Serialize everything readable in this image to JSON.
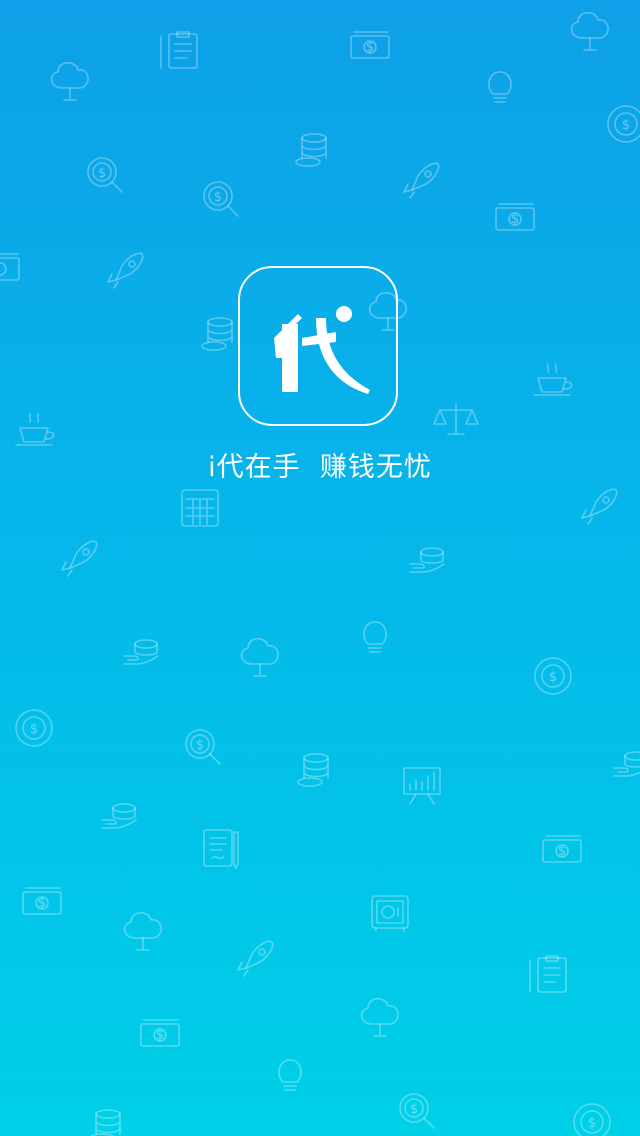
{
  "splash": {
    "slogan": "i代在手  赚钱无忧",
    "logo_icon": "dai-character-logo-icon",
    "background_gradient": [
      "#0ea0e8",
      "#00d0e8"
    ],
    "accent_color": "#ffffff"
  },
  "pattern": {
    "dollar_symbol": "$",
    "icons": [
      "money-tree-icon",
      "clipboard-icon",
      "banknote-icon",
      "lightbulb-icon",
      "coin-stack-icon",
      "dollar-magnifier-icon",
      "rocket-icon",
      "dollar-coin-icon",
      "coffee-cup-icon",
      "balance-scale-icon",
      "calculator-icon",
      "growth-chart-icon",
      "coin-hand-icon",
      "contract-icon",
      "safe-icon"
    ]
  }
}
